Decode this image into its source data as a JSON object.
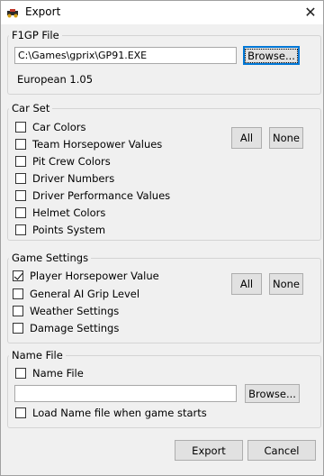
{
  "window": {
    "title": "Export",
    "close_label": "✕"
  },
  "f1gp": {
    "legend": "F1GP File",
    "path_value": "C:\\Games\\gprix\\GP91.EXE",
    "browse_label": "Browse...",
    "version": "European 1.05"
  },
  "carset": {
    "legend": "Car Set",
    "items": [
      {
        "label": "Car Colors",
        "checked": false
      },
      {
        "label": "Team Horsepower Values",
        "checked": false
      },
      {
        "label": "Pit Crew Colors",
        "checked": false
      },
      {
        "label": "Driver Numbers",
        "checked": false
      },
      {
        "label": "Driver Performance Values",
        "checked": false
      },
      {
        "label": "Helmet Colors",
        "checked": false
      },
      {
        "label": "Points System",
        "checked": false
      }
    ],
    "all_label": "All",
    "none_label": "None"
  },
  "game": {
    "legend": "Game Settings",
    "items": [
      {
        "label": "Player Horsepower Value",
        "checked": true
      },
      {
        "label": "General AI Grip Level",
        "checked": false
      },
      {
        "label": "Weather Settings",
        "checked": false
      },
      {
        "label": "Damage Settings",
        "checked": false
      }
    ],
    "all_label": "All",
    "none_label": "None"
  },
  "namefile": {
    "legend": "Name File",
    "checkbox_label": "Name File",
    "checkbox_checked": false,
    "path_value": "",
    "browse_label": "Browse...",
    "load_label": "Load Name file when game starts",
    "load_checked": false
  },
  "footer": {
    "export_label": "Export",
    "cancel_label": "Cancel"
  }
}
